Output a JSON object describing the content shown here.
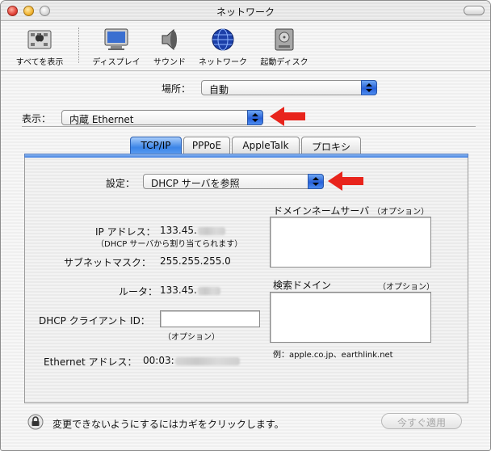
{
  "window": {
    "title": "ネットワーク"
  },
  "toolbar": {
    "items": [
      {
        "label": "すべてを表示",
        "icon": "show-all-icon"
      },
      {
        "label": "ディスプレイ",
        "icon": "display-icon"
      },
      {
        "label": "サウンド",
        "icon": "speaker-icon"
      },
      {
        "label": "ネットワーク",
        "icon": "globe-icon"
      },
      {
        "label": "起動ディスク",
        "icon": "disk-icon"
      }
    ]
  },
  "location": {
    "label": "場所：",
    "value": "自動"
  },
  "show": {
    "label": "表示：",
    "value": "内蔵 Ethernet"
  },
  "tabs": [
    {
      "label": "TCP/IP",
      "selected": true
    },
    {
      "label": "PPPoE",
      "selected": false
    },
    {
      "label": "AppleTalk",
      "selected": false
    },
    {
      "label": "プロキシ",
      "selected": false
    }
  ],
  "tcpip": {
    "config_label": "設定：",
    "config_value": "DHCP サーバを参照",
    "ip_label": "IP アドレス：",
    "ip_value": "133.45.",
    "ip_note": "（DHCP サーバから割り当てられます）",
    "subnet_label": "サブネットマスク：",
    "subnet_value": "255.255.255.0",
    "router_label": "ルータ：",
    "router_value": "133.45.",
    "dhcp_client_label": "DHCP クライアント ID：",
    "dhcp_client_value": "",
    "dhcp_client_note": "（オプション）",
    "ethernet_label": "Ethernet アドレス：",
    "ethernet_value": "00:03:",
    "dns_label": "ドメインネームサーバ",
    "dns_optional": "（オプション）",
    "search_label": "検索ドメイン",
    "search_optional": "（オプション）",
    "example": "例：apple.co.jp、earthlink.net"
  },
  "footer": {
    "lock_text": "変更できないようにするにはカギをクリックします。",
    "apply_button": "今すぐ適用"
  },
  "colors": {
    "arrow_red": "#e8241c",
    "tab_selected": "#3b85e8",
    "popup_blue": "#2760d8"
  }
}
